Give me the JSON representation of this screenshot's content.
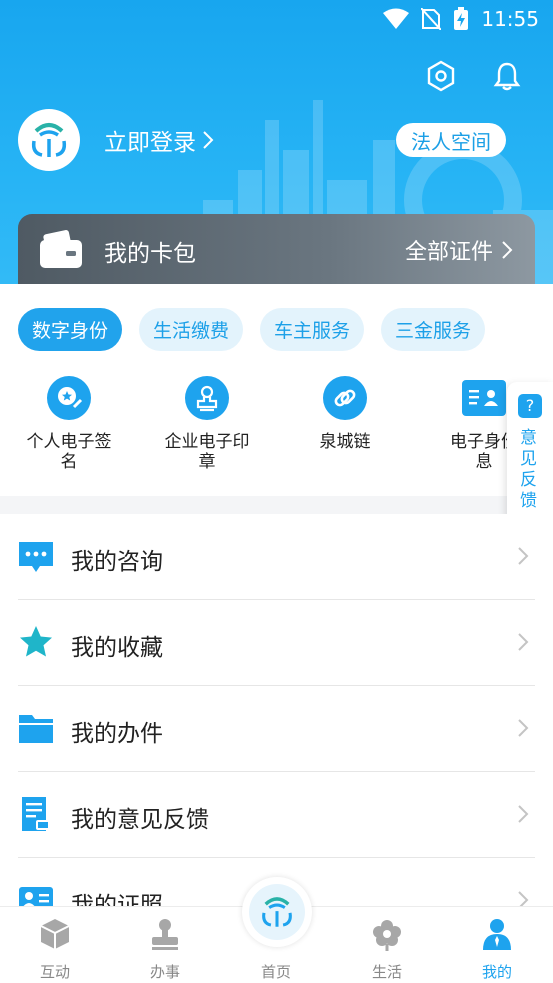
{
  "status_bar": {
    "time": "11:55"
  },
  "header": {
    "login_label": "立即登录",
    "legal_space_label": "法人空间",
    "icons": [
      "settings-icon",
      "bell-icon"
    ]
  },
  "card_bag": {
    "title": "我的卡包",
    "all_label": "全部证件"
  },
  "tabs": [
    {
      "label": "数字身份",
      "active": true
    },
    {
      "label": "生活缴费",
      "active": false
    },
    {
      "label": "车主服务",
      "active": false
    },
    {
      "label": "三金服务",
      "active": false
    }
  ],
  "services": [
    {
      "line1": "个人电子签",
      "line2": "名",
      "icon": "signature-icon"
    },
    {
      "line1": "企业电子印",
      "line2": "章",
      "icon": "seal-icon"
    },
    {
      "line1": "泉城链",
      "line2": "",
      "icon": "chain-icon"
    },
    {
      "line1": "电子身份",
      "line2": "息",
      "icon": "id-card-icon"
    }
  ],
  "feedback_tab": {
    "q": "?",
    "text": "意见反馈"
  },
  "list": [
    {
      "label": "我的咨询",
      "icon": "chat-icon"
    },
    {
      "label": "我的收藏",
      "icon": "star-icon"
    },
    {
      "label": "我的办件",
      "icon": "folder-icon"
    },
    {
      "label": "我的意见反馈",
      "icon": "feedback-doc-icon"
    },
    {
      "label": "我的证照",
      "icon": "license-icon"
    }
  ],
  "bottom_nav": [
    {
      "label": "互动",
      "icon": "cube-icon",
      "active": false
    },
    {
      "label": "办事",
      "icon": "stamp-icon",
      "active": false
    },
    {
      "label": "首页",
      "icon": "home-logo-icon",
      "active": false
    },
    {
      "label": "生活",
      "icon": "flower-icon",
      "active": false
    },
    {
      "label": "我的",
      "icon": "user-icon",
      "active": true
    }
  ],
  "colors": {
    "primary": "#1ea3ee",
    "header_top": "#18a6ef",
    "card_bag": "#5c6770"
  }
}
